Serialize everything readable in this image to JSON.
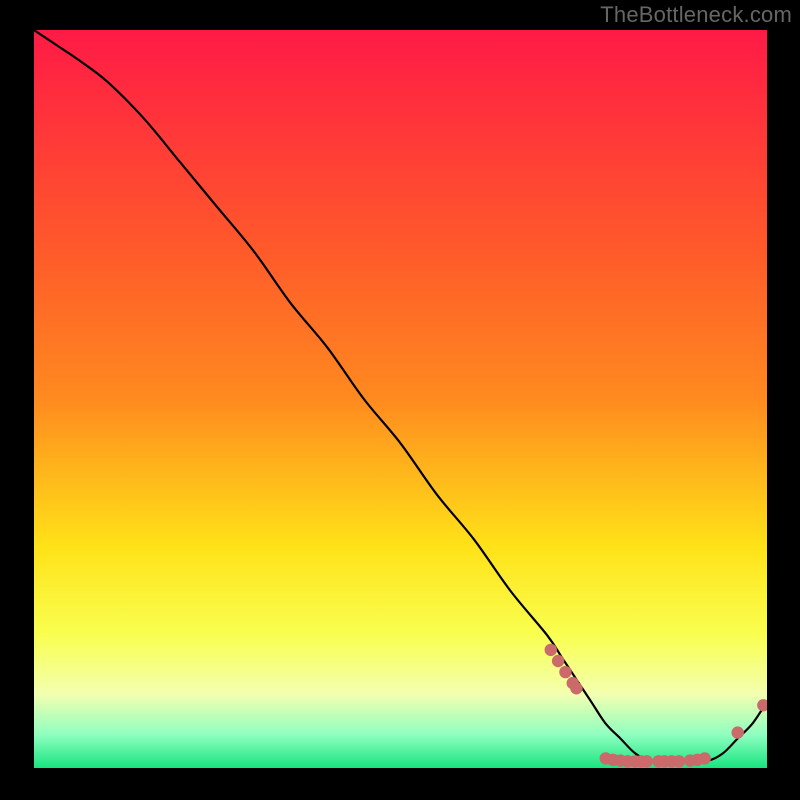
{
  "watermark": "TheBottleneck.com",
  "colors": {
    "curve": "#000000",
    "marker_fill": "#cb6a6a",
    "marker_stroke": "#cb6a6a",
    "gradient_top": "#ff1a46",
    "gradient_mid_upper": "#ff8a1f",
    "gradient_mid": "#ffe218",
    "gradient_mid_lower": "#f9ff50",
    "gradient_low_yellow": "#f3ffb0",
    "gradient_mint": "#8effc0",
    "gradient_green": "#18e47f"
  },
  "chart_data": {
    "type": "line",
    "title": "",
    "xlabel": "",
    "ylabel": "",
    "xlim": [
      0,
      100
    ],
    "ylim": [
      0,
      100
    ],
    "x": [
      0,
      3,
      6,
      10,
      15,
      20,
      25,
      30,
      35,
      40,
      45,
      50,
      55,
      60,
      65,
      70,
      72,
      74,
      76,
      78,
      80,
      82,
      84,
      86,
      88,
      90,
      92,
      94,
      96,
      98,
      100
    ],
    "y": [
      100,
      98,
      96,
      93,
      88,
      82,
      76,
      70,
      63,
      57,
      50,
      44,
      37,
      31,
      24,
      18,
      15,
      12,
      9,
      6,
      4,
      2,
      1,
      1,
      1,
      1,
      1,
      2,
      4,
      6,
      9
    ],
    "markers": [
      {
        "x": 70.5,
        "y": 16.0
      },
      {
        "x": 71.5,
        "y": 14.5
      },
      {
        "x": 72.5,
        "y": 13.0
      },
      {
        "x": 73.5,
        "y": 11.5
      },
      {
        "x": 74.0,
        "y": 10.8
      },
      {
        "x": 78.0,
        "y": 1.3
      },
      {
        "x": 79.0,
        "y": 1.1
      },
      {
        "x": 80.0,
        "y": 1.0
      },
      {
        "x": 81.0,
        "y": 0.9
      },
      {
        "x": 82.0,
        "y": 0.9
      },
      {
        "x": 82.8,
        "y": 0.9
      },
      {
        "x": 83.6,
        "y": 0.9
      },
      {
        "x": 85.2,
        "y": 0.9
      },
      {
        "x": 86.0,
        "y": 0.9
      },
      {
        "x": 87.0,
        "y": 0.9
      },
      {
        "x": 88.0,
        "y": 0.9
      },
      {
        "x": 89.5,
        "y": 1.0
      },
      {
        "x": 90.5,
        "y": 1.1
      },
      {
        "x": 91.5,
        "y": 1.3
      },
      {
        "x": 96.0,
        "y": 4.8
      },
      {
        "x": 99.5,
        "y": 8.5
      }
    ]
  }
}
